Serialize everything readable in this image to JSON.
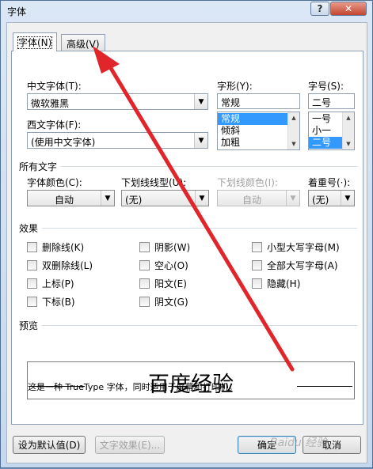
{
  "window": {
    "title": "字体",
    "help_glyph": "?",
    "close_glyph": "✕"
  },
  "tabs": [
    {
      "label": "字体(N)"
    },
    {
      "label": "高级(V)"
    }
  ],
  "chinese_font": {
    "label": "中文字体(T):",
    "value": "微软雅黑"
  },
  "western_font": {
    "label": "西文字体(F):",
    "value": "(使用中文字体)"
  },
  "font_style": {
    "label": "字形(Y):",
    "value": "常规",
    "options": [
      "常规",
      "倾斜",
      "加粗"
    ]
  },
  "font_size": {
    "label": "字号(S):",
    "value": "二号",
    "options": [
      "一号",
      "小一",
      "二号"
    ]
  },
  "all_text": {
    "title": "所有文字",
    "font_color": {
      "label": "字体颜色(C):",
      "value": "自动"
    },
    "underline_style": {
      "label": "下划线线型(U):",
      "value": "(无)"
    },
    "underline_color": {
      "label": "下划线颜色(I):",
      "value": "自动"
    },
    "emphasis": {
      "label": "着重号(·):",
      "value": "(无)"
    }
  },
  "effects": {
    "title": "效果",
    "items": [
      {
        "label": "删除线(K)"
      },
      {
        "label": "双删除线(L)"
      },
      {
        "label": "上标(P)"
      },
      {
        "label": "下标(B)"
      },
      {
        "label": "阴影(W)"
      },
      {
        "label": "空心(O)"
      },
      {
        "label": "阳文(E)"
      },
      {
        "label": "阴文(G)"
      },
      {
        "label": "小型大写字母(M)"
      },
      {
        "label": "全部大写字母(A)"
      },
      {
        "label": "隐藏(H)"
      }
    ]
  },
  "preview": {
    "title": "预览",
    "sample_text": "百度经验",
    "description": "这是一种 TrueType 字体，同时适用于屏幕和打印机。"
  },
  "buttons": {
    "set_default": "设为默认值(D)",
    "text_effects": "文字效果(E)...",
    "ok": "确定",
    "cancel": "取消"
  },
  "watermark": "Baidu 经验",
  "colors": {
    "annotation_arrow": "#e0262b",
    "selection": "#3399ff"
  }
}
